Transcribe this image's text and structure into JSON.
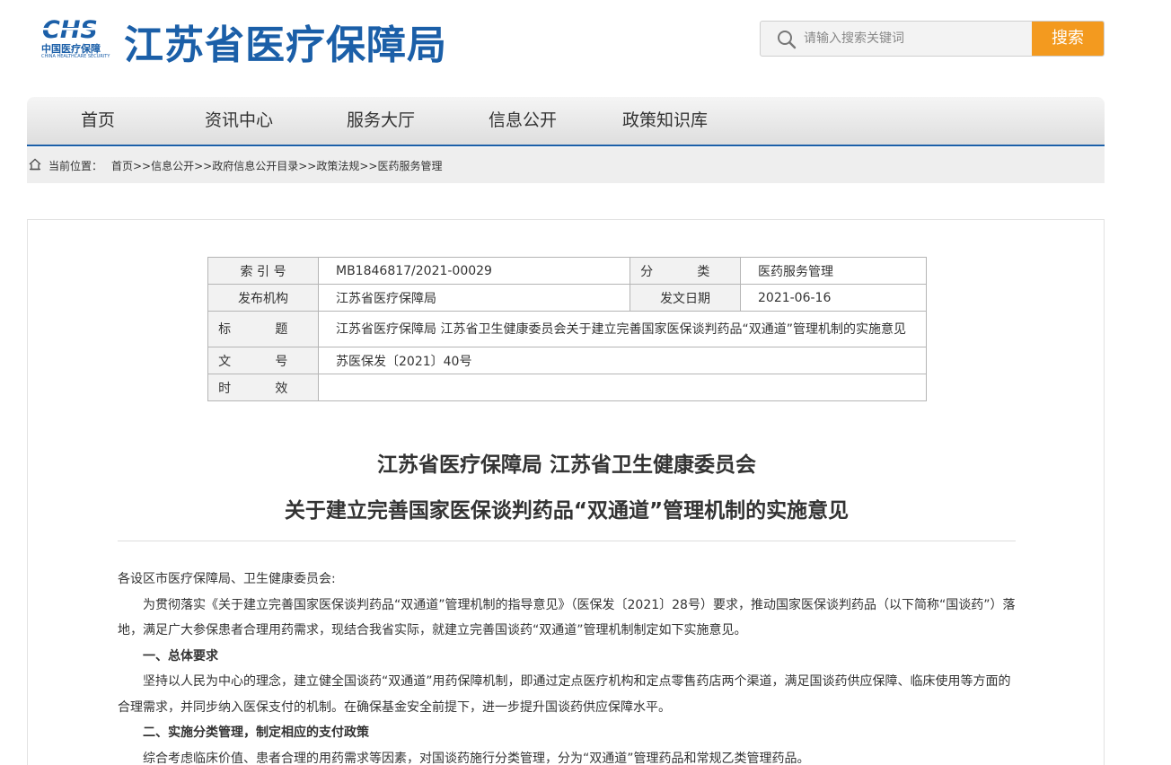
{
  "header": {
    "logo_mark": "CHS",
    "logo_cn": "中国医疗保障",
    "logo_en": "CHINA HEALTHCARE SECURITY",
    "site_title": "江苏省医疗保障局",
    "search": {
      "placeholder": "请输入搜索关键词",
      "button_label": "搜索"
    },
    "brand_color": "#1b5fa8",
    "accent_color": "#f39a1f"
  },
  "nav": {
    "items": [
      {
        "label": "首页"
      },
      {
        "label": "资讯中心"
      },
      {
        "label": "服务大厅"
      },
      {
        "label": "信息公开"
      },
      {
        "label": "政策知识库"
      }
    ]
  },
  "breadcrumb": {
    "label": "当前位置：",
    "path": "首页>>信息公开>>政府信息公开目录>>政策法规>>医药服务管理"
  },
  "meta": {
    "index_no_label": "索 引 号",
    "index_no": "MB1846817/2021-00029",
    "category_label": "分 类",
    "category": "医药服务管理",
    "publisher_label": "发布机构",
    "publisher": "江苏省医疗保障局",
    "issue_date_label": "发文日期",
    "issue_date": "2021-06-16",
    "title_label": "标 题",
    "title": "江苏省医疗保障局 江苏省卫生健康委员会关于建立完善国家医保谈判药品“双通道”管理机制的实施意见",
    "doc_no_label": "文 号",
    "doc_no": "苏医保发〔2021〕40号",
    "validity_label": "时 效",
    "validity": ""
  },
  "article": {
    "title_line1": "江苏省医疗保障局 江苏省卫生健康委员会",
    "title_line2": "关于建立完善国家医保谈判药品“双通道”管理机制的实施意见",
    "salutation": "各设区市医疗保障局、卫生健康委员会:",
    "p1": "为贯彻落实《关于建立完善国家医保谈判药品“双通道”管理机制的指导意见》（医保发〔2021〕28号）要求，推动国家医保谈判药品（以下简称“国谈药”）落地，满足广大参保患者合理用药需求，现结合我省实际，就建立完善国谈药“双通道”管理机制制定如下实施意见。",
    "h1": "一、总体要求",
    "p2": "坚持以人民为中心的理念，建立健全国谈药“双通道”用药保障机制，即通过定点医疗机构和定点零售药店两个渠道，满足国谈药供应保障、临床使用等方面的合理需求，并同步纳入医保支付的机制。在确保基金安全前提下，进一步提升国谈药供应保障水平。",
    "h2": "二、实施分类管理，制定相应的支付政策",
    "p3": "综合考虑临床价值、患者合理的用药需求等因素，对国谈药施行分类管理，分为“双通道”管理药品和常规乙类管理药品。"
  }
}
